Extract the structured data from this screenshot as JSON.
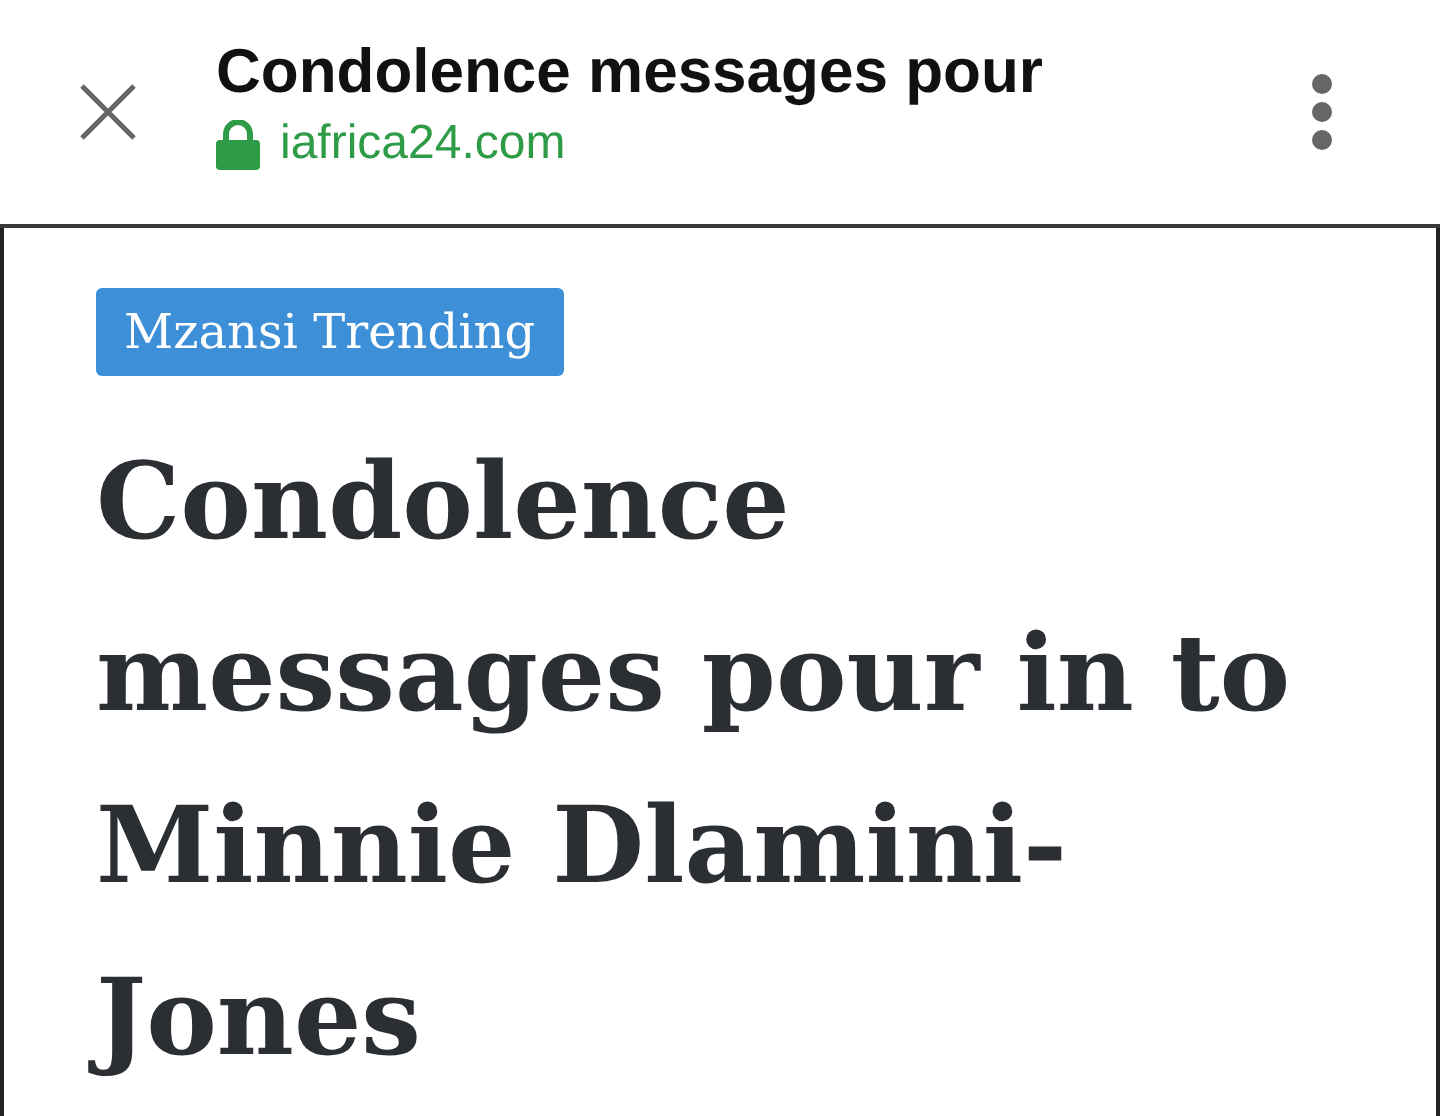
{
  "toolbar": {
    "title": "Condolence messages pour",
    "url": "iafrica24.com",
    "secure": true
  },
  "article": {
    "category": "Mzansi Trending",
    "headline": "Condolence messages pour in to Minnie Dlamini-Jones"
  }
}
